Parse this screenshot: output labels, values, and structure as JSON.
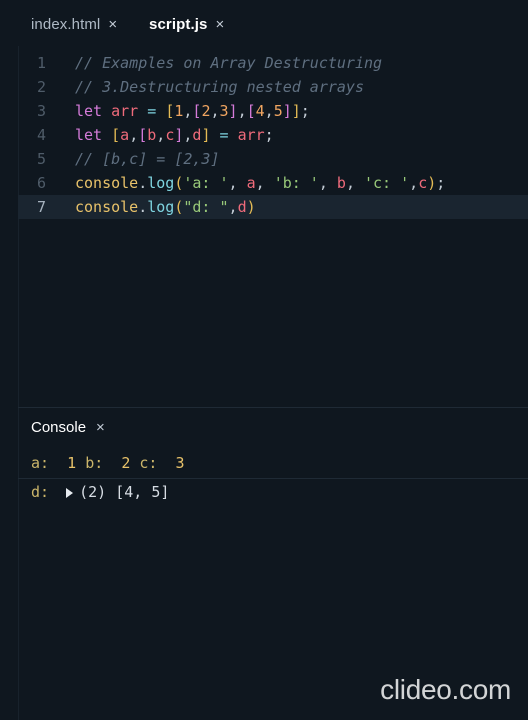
{
  "tabs": [
    {
      "label": "index.html",
      "active": false
    },
    {
      "label": "script.js",
      "active": true
    }
  ],
  "close_glyph": "×",
  "editor": {
    "lines": [
      {
        "n": "1",
        "tokens": [
          {
            "t": "// Examples on Array Destructuring",
            "c": "c-comment"
          }
        ]
      },
      {
        "n": "2",
        "tokens": [
          {
            "t": "// 3.Destructuring nested arrays",
            "c": "c-comment"
          }
        ]
      },
      {
        "n": "3",
        "tokens": [
          {
            "t": "let ",
            "c": "c-kw"
          },
          {
            "t": "arr",
            "c": "c-var"
          },
          {
            "t": " = ",
            "c": "c-op"
          },
          {
            "t": "[",
            "c": "c-brk"
          },
          {
            "t": "1",
            "c": "c-num"
          },
          {
            "t": ",",
            "c": "c-punc"
          },
          {
            "t": "[",
            "c": "c-kw"
          },
          {
            "t": "2",
            "c": "c-num"
          },
          {
            "t": ",",
            "c": "c-punc"
          },
          {
            "t": "3",
            "c": "c-num"
          },
          {
            "t": "]",
            "c": "c-kw"
          },
          {
            "t": ",",
            "c": "c-punc"
          },
          {
            "t": "[",
            "c": "c-kw"
          },
          {
            "t": "4",
            "c": "c-num"
          },
          {
            "t": ",",
            "c": "c-punc"
          },
          {
            "t": "5",
            "c": "c-num"
          },
          {
            "t": "]",
            "c": "c-kw"
          },
          {
            "t": "]",
            "c": "c-brk"
          },
          {
            "t": ";",
            "c": "c-punc"
          }
        ]
      },
      {
        "n": "4",
        "tokens": [
          {
            "t": "let ",
            "c": "c-kw"
          },
          {
            "t": "[",
            "c": "c-brk"
          },
          {
            "t": "a",
            "c": "c-var"
          },
          {
            "t": ",",
            "c": "c-punc"
          },
          {
            "t": "[",
            "c": "c-kw"
          },
          {
            "t": "b",
            "c": "c-var"
          },
          {
            "t": ",",
            "c": "c-punc"
          },
          {
            "t": "c",
            "c": "c-var"
          },
          {
            "t": "]",
            "c": "c-kw"
          },
          {
            "t": ",",
            "c": "c-punc"
          },
          {
            "t": "d",
            "c": "c-var"
          },
          {
            "t": "]",
            "c": "c-brk"
          },
          {
            "t": " = ",
            "c": "c-op"
          },
          {
            "t": "arr",
            "c": "c-var"
          },
          {
            "t": ";",
            "c": "c-punc"
          }
        ]
      },
      {
        "n": "5",
        "tokens": [
          {
            "t": "// [b,c] = [2,3]",
            "c": "c-comment"
          }
        ]
      },
      {
        "n": "6",
        "tokens": [
          {
            "t": "console",
            "c": "c-fn"
          },
          {
            "t": ".",
            "c": "c-punc"
          },
          {
            "t": "log",
            "c": "c-op"
          },
          {
            "t": "(",
            "c": "c-brk"
          },
          {
            "t": "'a: '",
            "c": "c-str"
          },
          {
            "t": ", ",
            "c": "c-punc"
          },
          {
            "t": "a",
            "c": "c-var"
          },
          {
            "t": ", ",
            "c": "c-punc"
          },
          {
            "t": "'b: '",
            "c": "c-str"
          },
          {
            "t": ", ",
            "c": "c-punc"
          },
          {
            "t": "b",
            "c": "c-var"
          },
          {
            "t": ", ",
            "c": "c-punc"
          },
          {
            "t": "'c: '",
            "c": "c-str"
          },
          {
            "t": ",",
            "c": "c-punc"
          },
          {
            "t": "c",
            "c": "c-var"
          },
          {
            "t": ")",
            "c": "c-brk"
          },
          {
            "t": ";",
            "c": "c-punc"
          }
        ]
      },
      {
        "n": "7",
        "active": true,
        "tokens": [
          {
            "t": "console",
            "c": "c-fn"
          },
          {
            "t": ".",
            "c": "c-punc"
          },
          {
            "t": "log",
            "c": "c-op"
          },
          {
            "t": "(",
            "c": "c-brk"
          },
          {
            "t": "\"d: \"",
            "c": "c-str"
          },
          {
            "t": ",",
            "c": "c-punc"
          },
          {
            "t": "d",
            "c": "c-var"
          },
          {
            "t": ")",
            "c": "c-brk"
          }
        ]
      }
    ]
  },
  "console": {
    "title": "Console",
    "row1": {
      "a_label": "a:",
      "a_val": "1",
      "b_label": "b:",
      "b_val": "2",
      "c_label": "c:",
      "c_val": "3"
    },
    "row2": {
      "label": "d:",
      "value": "(2) [4, 5]"
    }
  },
  "watermark": "clideo.com",
  "colors": {
    "background": "#0f171f",
    "active_line": "#1a2530",
    "keyword": "#d57bd9",
    "variable": "#ef6b7b",
    "string": "#98c879",
    "number": "#f0a561",
    "comment": "#5f6f80"
  }
}
